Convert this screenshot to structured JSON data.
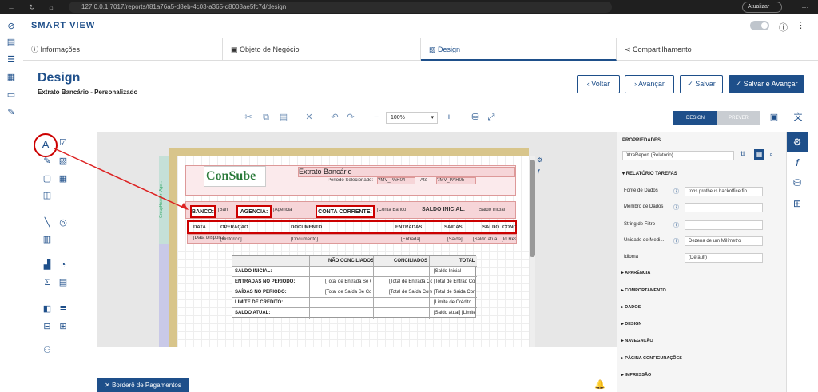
{
  "browser": {
    "url": "127.0.0.1:7017/reports/f81a76a5-d8eb-4c03-a365-d8008ae5fc7d/design",
    "update_label": "Atualizar"
  },
  "header": {
    "app_title": "SMART VIEW"
  },
  "tabs": [
    {
      "label": "Informações"
    },
    {
      "label": "Objeto de Negócio"
    },
    {
      "label": "Design"
    },
    {
      "label": "Compartilhamento"
    }
  ],
  "page": {
    "title": "Design",
    "subtitle": "Extrato Bancário - Personalizado"
  },
  "actions": {
    "back": "Voltar",
    "next": "Avançar",
    "save": "Salvar",
    "save_next": "Salvar e Avançar"
  },
  "toolbar": {
    "zoom": "100%",
    "design_tab": "DESIGN",
    "preview_tab": "PREVER"
  },
  "report": {
    "logo_text": "ConSube",
    "title": "Extrato Bancário",
    "periodo": "Periodo Selecionado:",
    "par04": "?MV_PAR04",
    "ate": "Até",
    "par05": "?MV_PAR05",
    "band_label": "GroupHeader [Age...",
    "banco_label": "BANCO:",
    "banco_val": "[Ban",
    "agencia_label": "AGENCIA:",
    "agencia_val": "[Agencia",
    "conta_label": "CONTA CORRENTE:",
    "conta_val": "[Conta Banco",
    "saldo_label": "SALDO INICIAL:",
    "saldo_val": "[Saldo Inicial",
    "columns": [
      "DATA",
      "OPERAÇÃO",
      "DOCUMENTO",
      "ENTRADAS",
      "SAIDAS",
      "SALDO",
      "CONC"
    ],
    "detail": [
      "[Data Dispon.]",
      "[Historico]",
      "[Documento]",
      "[Entrada]",
      "[Saida]",
      "[Saldo atua",
      "[Id Result"
    ],
    "summary_headers": [
      "NÃO CONCILIADOS",
      "CONCILIADOS",
      "TOTAL"
    ],
    "summary_rows": [
      {
        "label": "SALDO INICIAL:",
        "nc": "",
        "c": "",
        "t": "[Saldo Inicial"
      },
      {
        "label": "ENTRADAS NO PERIODO:",
        "nc": "[Total de Entrada Se Conciliado]",
        "c": "[Total de Entrada Conciliado]",
        "t": "[Total de Entrad Conciliado] + [Total"
      },
      {
        "label": "SAÍDAS NO PERIODO:",
        "nc": "[Total de Saída Se Conciliado]",
        "c": "[Total de Saída Conciliado]",
        "t": "[Total de Saida Conciliado] + [Total"
      },
      {
        "label": "LIMITE DE CREDITO:",
        "nc": "",
        "c": "",
        "t": "[Limite de Crédito"
      },
      {
        "label": "SALDO ATUAL:",
        "nc": "",
        "c": "",
        "t": "[Saldo atual] [Limite de Crédito"
      }
    ]
  },
  "properties": {
    "title": "PROPRIEDADES",
    "object": "XtraReport (Relatório)",
    "section": "RELATÓRIO TAREFAS",
    "rows": [
      {
        "label": "Fonte de Dados",
        "value": "tohs.protheus.backoffice.fin..."
      },
      {
        "label": "Membro de Dados",
        "value": ""
      },
      {
        "label": "String de Filtro",
        "value": ""
      },
      {
        "label": "Unidade de Medi...",
        "value": "Dezena de um Milímetro"
      },
      {
        "label": "Idioma",
        "value": "(Default)"
      }
    ],
    "sections": [
      "APARÊNCIA",
      "COMPORTAMENTO",
      "DADOS",
      "DESIGN",
      "NAVEGAÇÃO",
      "PÁGINA CONFIGURAÇÕES",
      "IMPRESSÃO"
    ]
  },
  "footer": {
    "bordero": "Borderô de Pagamentos"
  }
}
